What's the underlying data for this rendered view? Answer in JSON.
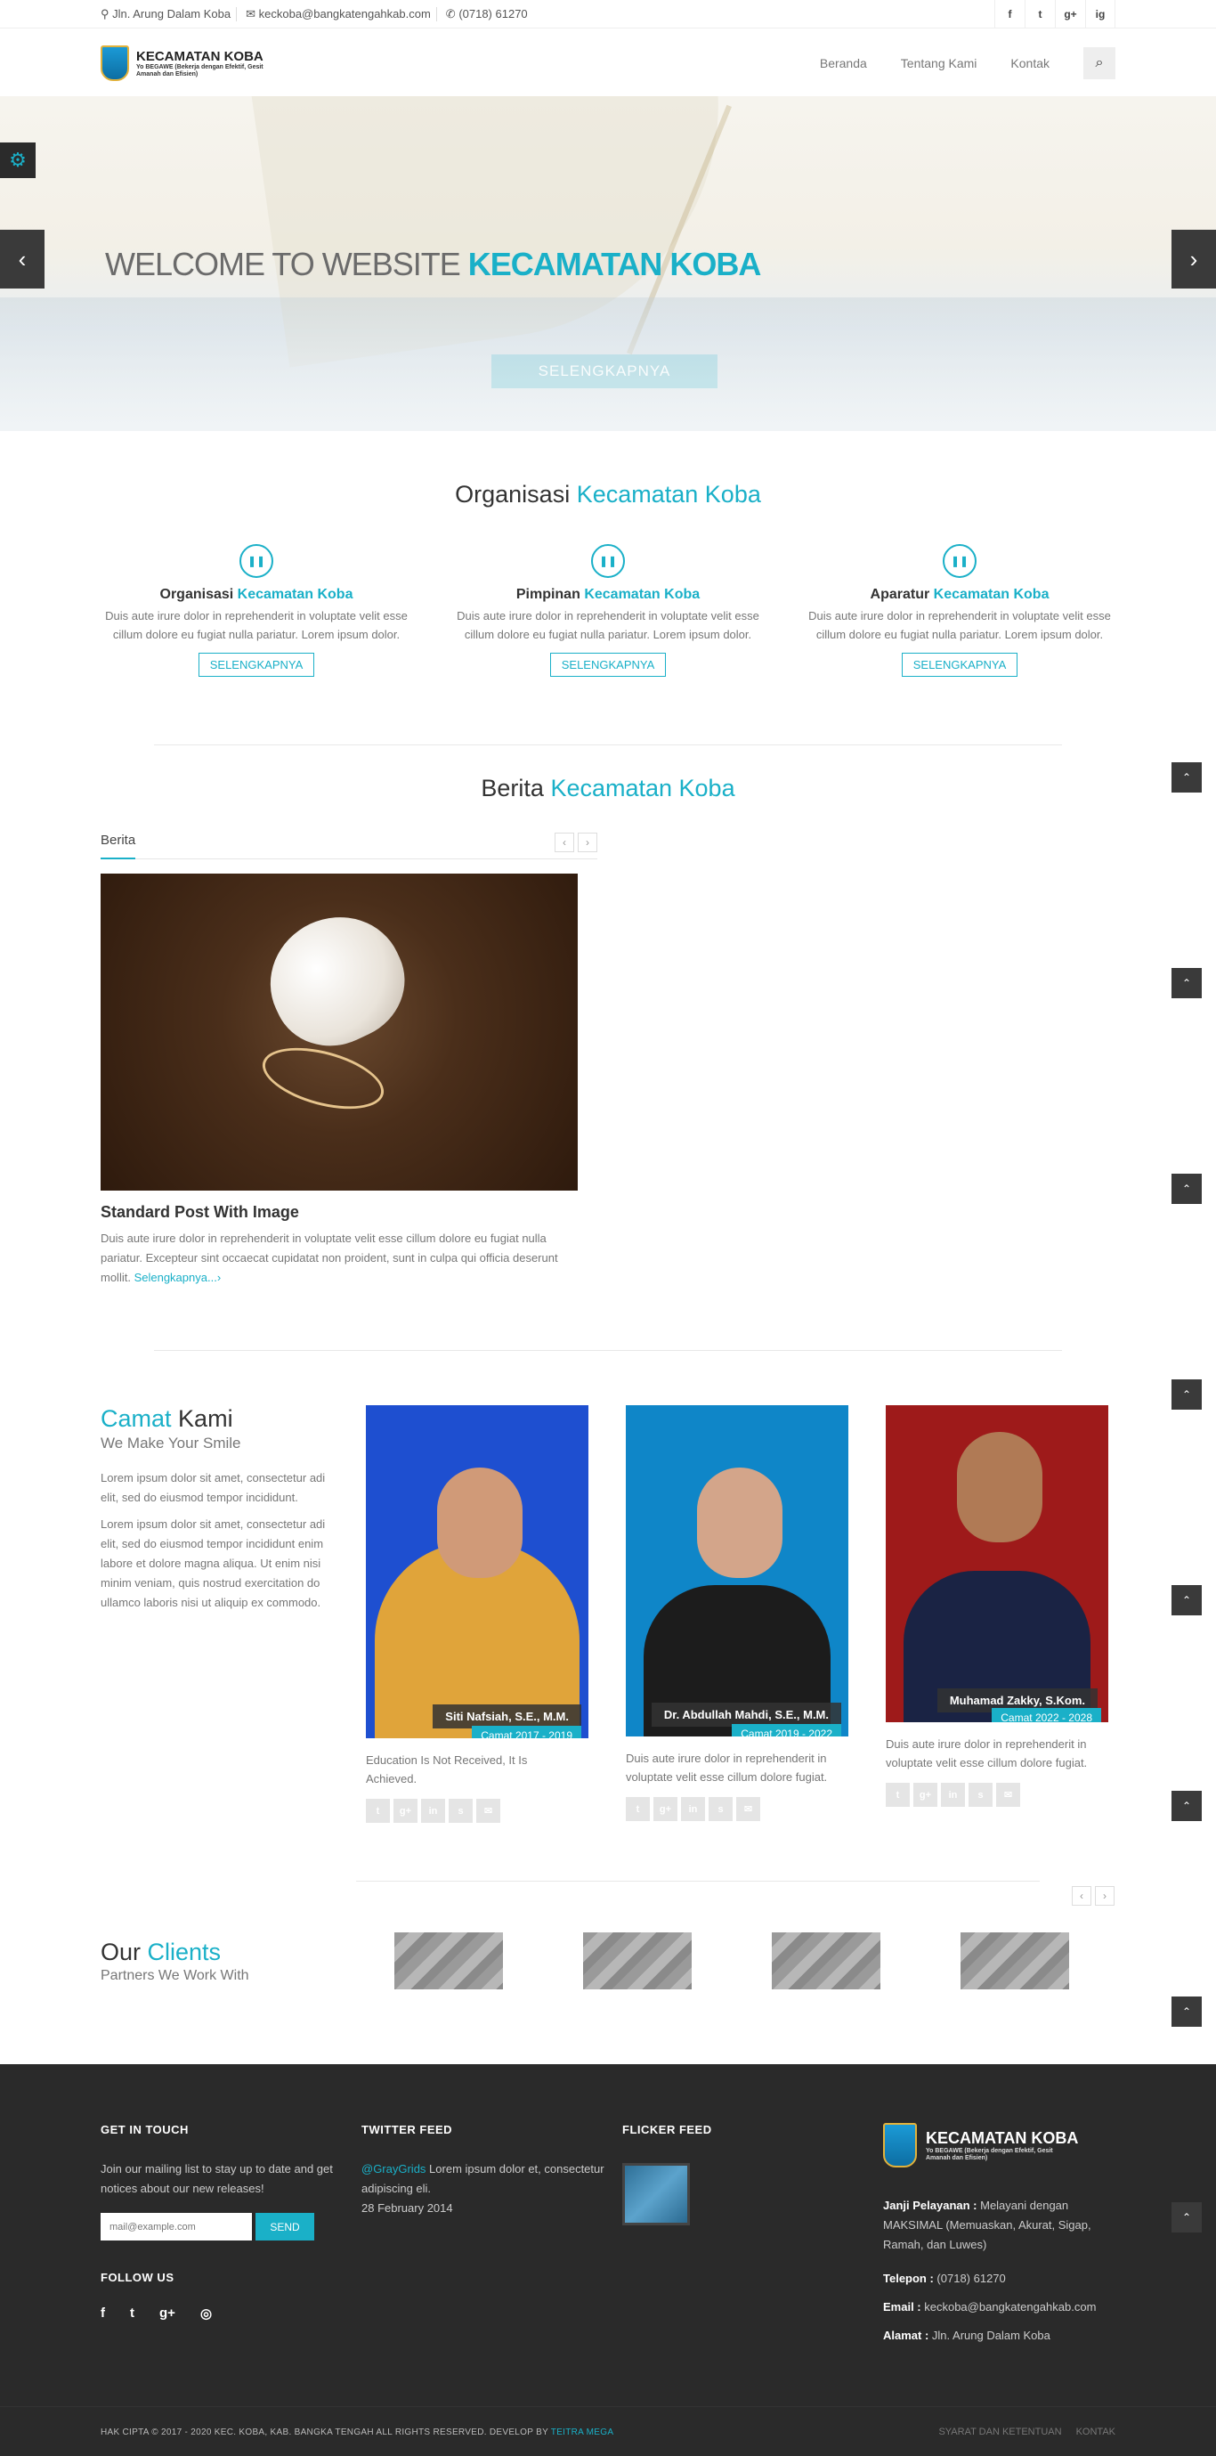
{
  "topbar": {
    "address": "Jln. Arung Dalam Koba",
    "email": "keckoba@bangkatengahkab.com",
    "phone": "(0718) 61270",
    "social": [
      "f",
      "t",
      "g+",
      "ig"
    ]
  },
  "header": {
    "logo_title": "KECAMATAN KOBA",
    "logo_sub": "Yo BEGAWE (Bekerja dengan Efektif, Gesit Amanah dan Efisien)",
    "nav": [
      "Beranda",
      "Tentang Kami",
      "Kontak"
    ]
  },
  "slider": {
    "title": "WELCOME TO WEBSITE",
    "title_accent": "KECAMATAN KOBA",
    "button": "SELENGKAPNYA"
  },
  "organisasi": {
    "title": "Organisasi",
    "title_accent": "Kecamatan Koba",
    "items": [
      {
        "title": "Organisasi",
        "accent": "Kecamatan Koba",
        "text": "Duis aute irure dolor in reprehenderit in voluptate velit esse cillum dolore eu fugiat nulla pariatur. Lorem ipsum dolor.",
        "button": "SELENGKAPNYA"
      },
      {
        "title": "Pimpinan",
        "accent": "Kecamatan Koba",
        "text": "Duis aute irure dolor in reprehenderit in voluptate velit esse cillum dolore eu fugiat nulla pariatur. Lorem ipsum dolor.",
        "button": "SELENGKAPNYA"
      },
      {
        "title": "Aparatur",
        "accent": "Kecamatan Koba",
        "text": "Duis aute irure dolor in reprehenderit in voluptate velit esse cillum dolore eu fugiat nulla pariatur. Lorem ipsum dolor.",
        "button": "SELENGKAPNYA"
      }
    ]
  },
  "berita": {
    "title": "Berita",
    "title_accent": "Kecamatan Koba",
    "tab": "Berita",
    "post_title": "Standard Post With Image",
    "post_text": "Duis aute irure dolor in reprehenderit in voluptate velit esse cillum dolore eu fugiat nulla pariatur. Excepteur sint occaecat cupidatat non proident, sunt in culpa qui officia deserunt mollit.",
    "read_more": "Selengkapnya...›"
  },
  "camat": {
    "title_accent": "Camat",
    "title": "Kami",
    "subtitle": "We Make Your Smile",
    "p1": "Lorem ipsum dolor sit amet, consectetur adi elit, sed do eiusmod tempor incididunt.",
    "p2": "Lorem ipsum dolor sit amet, consectetur adi elit, sed do eiusmod tempor incididunt enim labore et dolore magna aliqua. Ut enim nisi minim veniam, quis nostrud exercitation do ullamco laboris nisi ut aliquip ex commodo.",
    "members": [
      {
        "name": "Siti Nafsiah, S.E., M.M.",
        "term": "Camat 2017 - 2019",
        "text": "Education Is Not Received, It Is Achieved."
      },
      {
        "name": "Dr. Abdullah Mahdi, S.E., M.M.",
        "term": "Camat 2019 - 2022",
        "text": "Duis aute irure dolor in reprehenderit in voluptate velit esse cillum dolore fugiat."
      },
      {
        "name": "Muhamad Zakky, S.Kom.",
        "term": "Camat 2022 - 2028",
        "text": "Duis aute irure dolor in reprehenderit in voluptate velit esse cillum dolore fugiat."
      }
    ]
  },
  "clients": {
    "title": "Our",
    "title_accent": "Clients",
    "subtitle": "Partners We Work With"
  },
  "footer": {
    "touch_title": "GET IN TOUCH",
    "touch_text": "Join our mailing list to stay up to date and get notices about our new releases!",
    "email_placeholder": "mail@example.com",
    "send": "SEND",
    "follow_title": "FOLLOW US",
    "twitter_title": "TWITTER FEED",
    "tweet_handle": "@GrayGrids",
    "tweet_text": " Lorem ipsum dolor et, consectetur adipiscing eli.",
    "tweet_date": "28 February 2014",
    "flicker_title": "FLICKER FEED",
    "logo_title": "KECAMATAN KOBA",
    "logo_sub": "Yo BEGAWE (Bekerja dengan Efektif, Gesit Amanah dan Efisien)",
    "janji_label": "Janji Pelayanan :",
    "janji_text": " Melayani dengan MAKSIMAL (Memuaskan, Akurat, Sigap, Ramah, dan Luwes)",
    "telepon_label": "Telepon :",
    "telepon": " (0718) 61270",
    "email_label": "Email :",
    "email": " keckoba@bangkatengahkab.com",
    "alamat_label": "Alamat :",
    "alamat": " Jln. Arung Dalam Koba",
    "copyright": "HAK CIPTA © 2017 - 2020 KEC. KOBA, KAB. BANGKA TENGAH ALL RIGHTS RESERVED. DEVELOP BY ",
    "developer": "TEITRA MEGA",
    "link1": "SYARAT DAN KETENTUAN",
    "link2": "KONTAK"
  }
}
